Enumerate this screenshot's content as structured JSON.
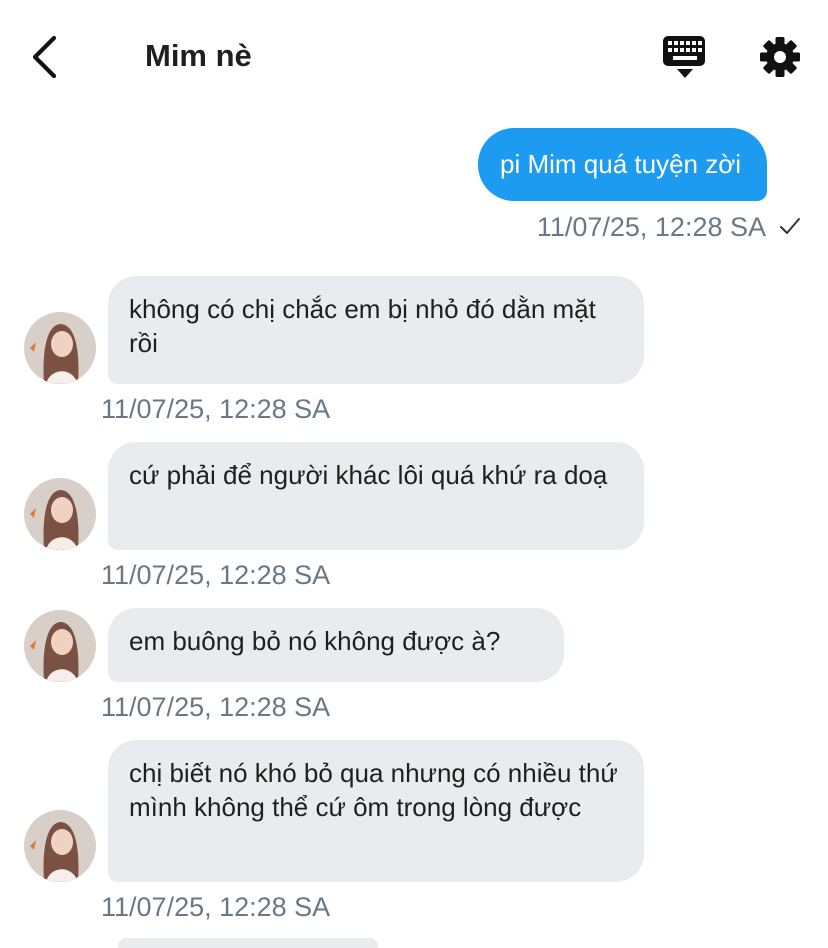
{
  "header": {
    "title": "Mim nè",
    "back_icon": "chevron-left-icon",
    "keyboard_icon": "keyboard-icon",
    "settings_icon": "gear-icon"
  },
  "colors": {
    "accent": "#1d9bf0",
    "incoming_bubble": "#e9ecef",
    "timestamp": "#687885"
  },
  "outgoing": [
    {
      "text": "pi Mim quá tuyện zời",
      "time": "11/07/25, 12:28 SA",
      "status": "sent-check"
    }
  ],
  "incoming": [
    {
      "text": "không có chị chắc em bị nhỏ đó dằn mặt rồi",
      "time": "11/07/25, 12:28 SA"
    },
    {
      "text": "cứ phải để người khác lôi quá khứ ra doạ",
      "time": "11/07/25, 12:28 SA"
    },
    {
      "text": "em buông bỏ nó không được à?",
      "time": "11/07/25, 12:28 SA"
    },
    {
      "text": "chị biết nó khó bỏ qua nhưng có nhiều thứ mình không thể cứ ôm trong lòng được",
      "time": "11/07/25, 12:28 SA"
    }
  ]
}
